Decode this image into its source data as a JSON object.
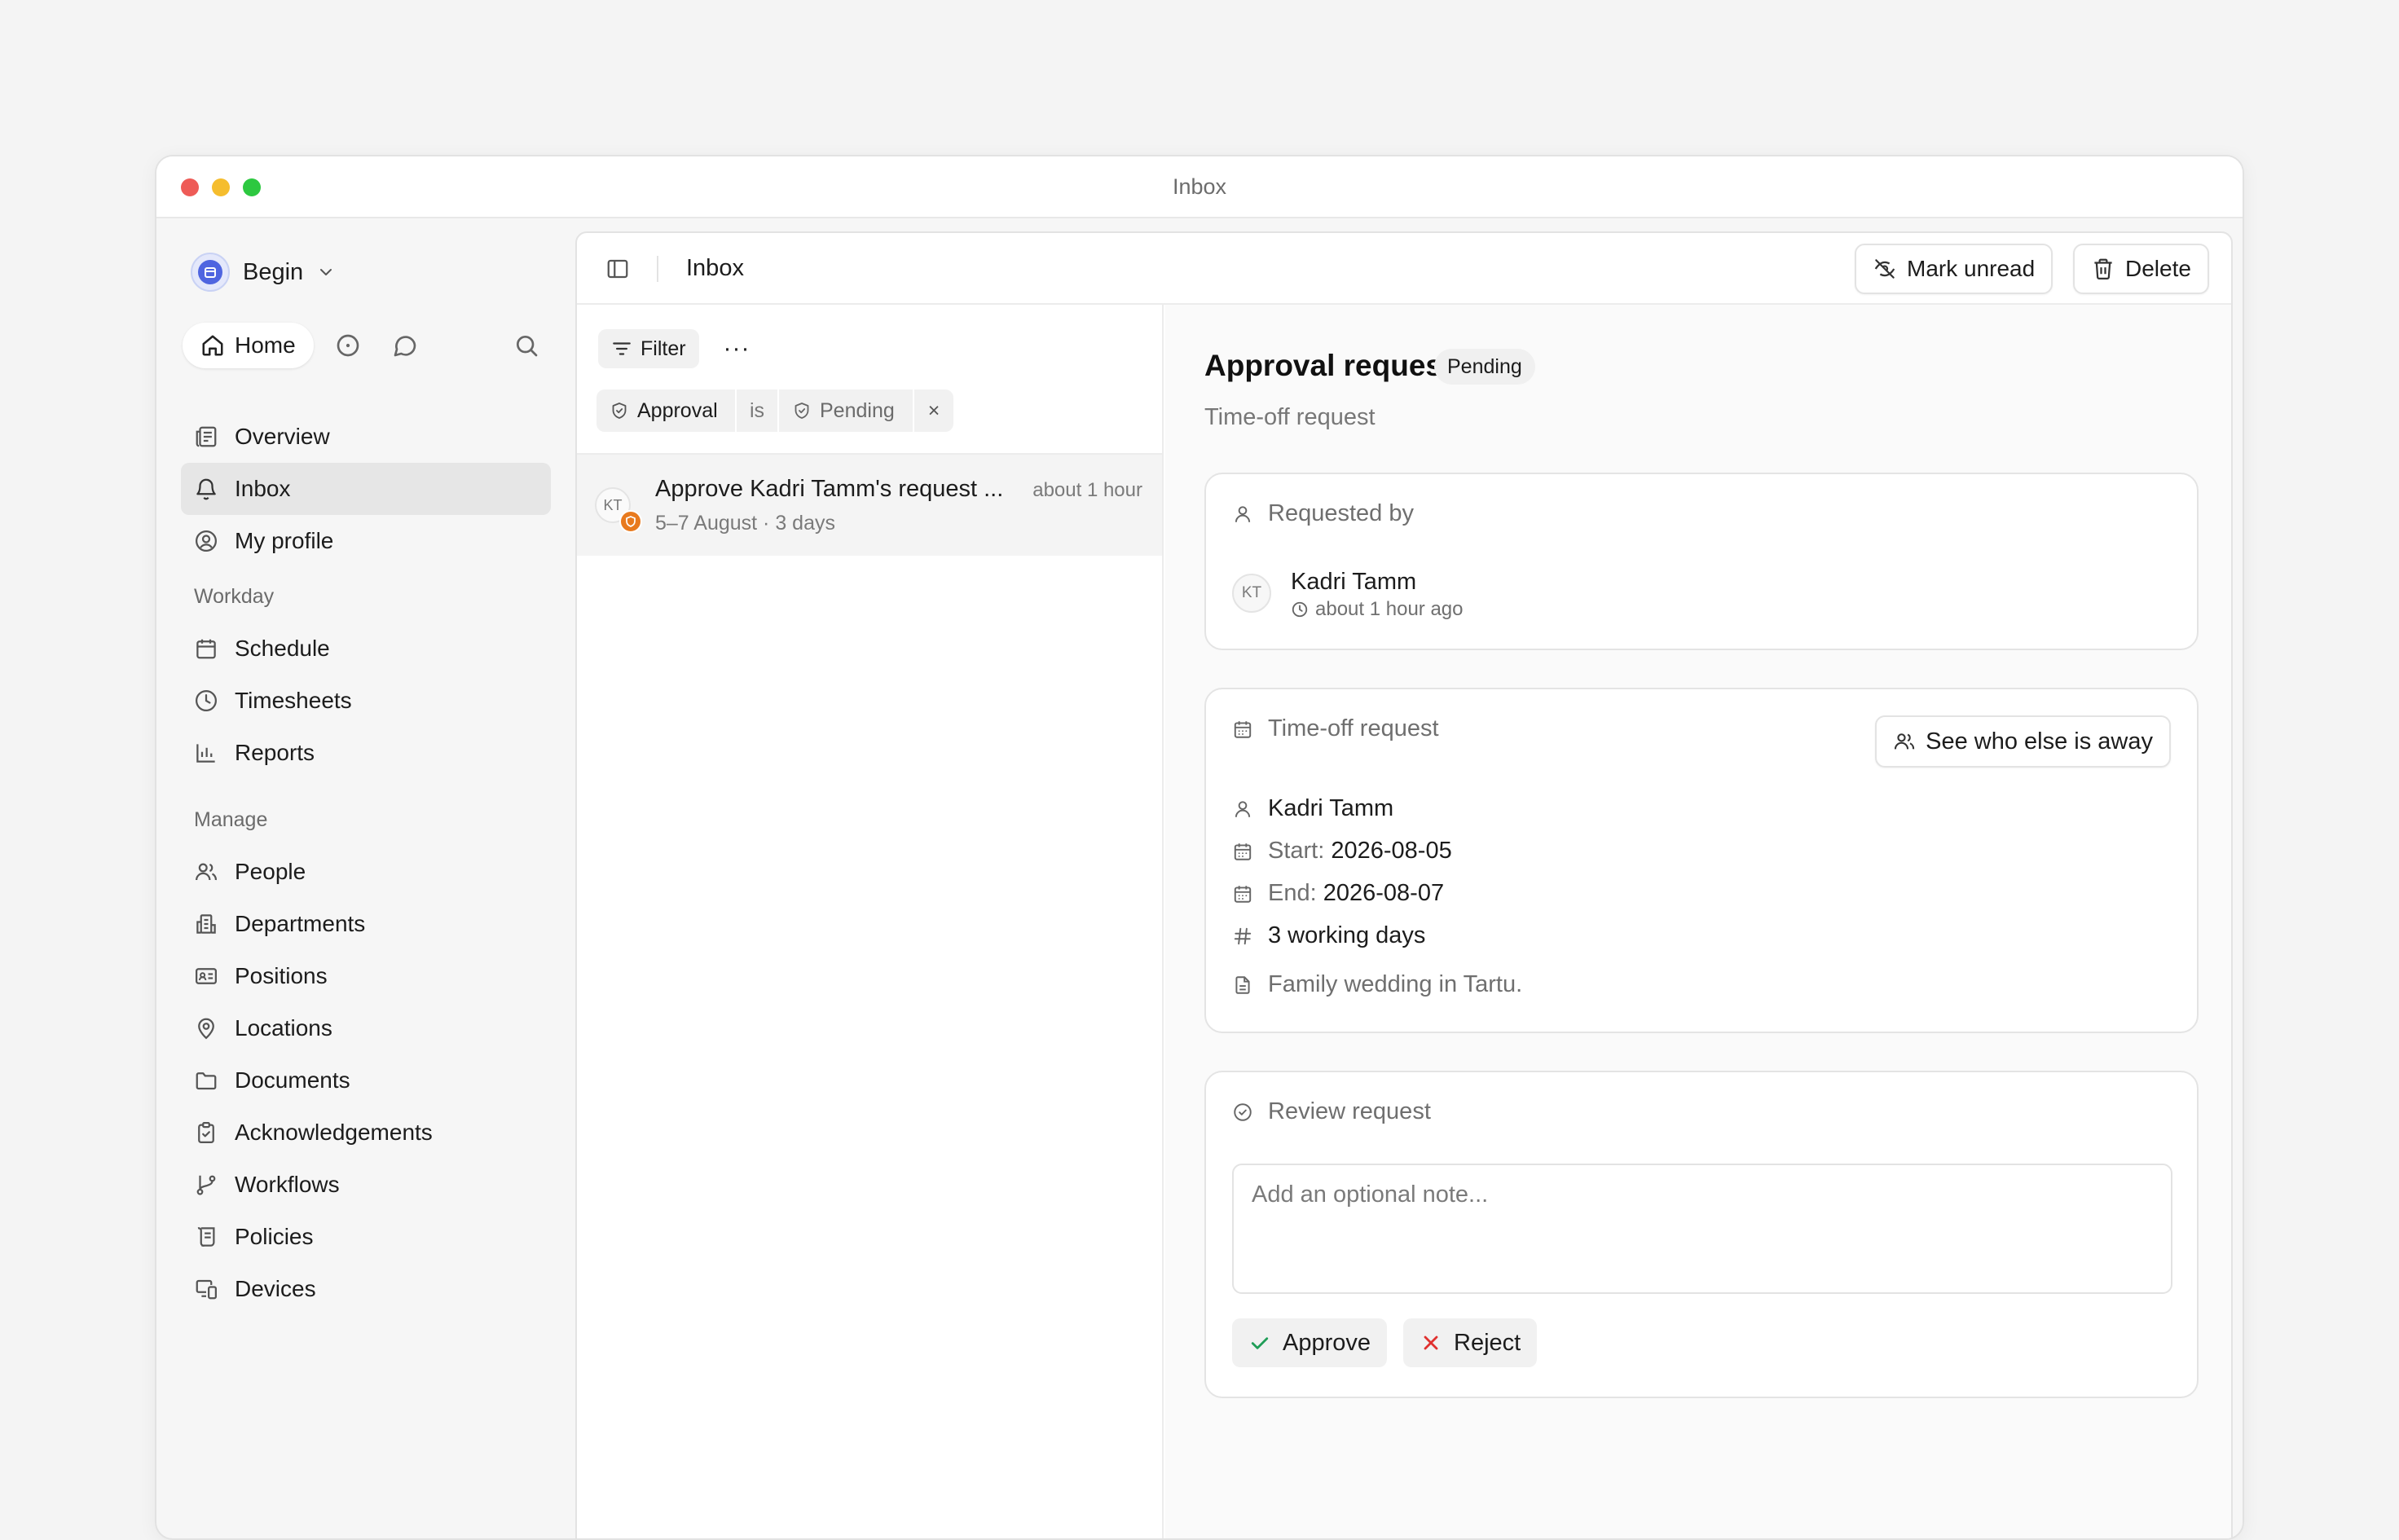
{
  "window": {
    "title": "Inbox"
  },
  "sidebar": {
    "workspace": "Begin",
    "home_label": "Home",
    "primary": [
      {
        "label": "Overview",
        "icon": "newspaper-icon"
      },
      {
        "label": "Inbox",
        "icon": "bell-icon",
        "active": true
      },
      {
        "label": "My profile",
        "icon": "user-circle-icon"
      }
    ],
    "workday_label": "Workday",
    "workday": [
      {
        "label": "Schedule",
        "icon": "calendar-icon"
      },
      {
        "label": "Timesheets",
        "icon": "clock-icon"
      },
      {
        "label": "Reports",
        "icon": "bar-chart-icon"
      }
    ],
    "manage_label": "Manage",
    "manage": [
      {
        "label": "People",
        "icon": "users-icon"
      },
      {
        "label": "Departments",
        "icon": "building-icon"
      },
      {
        "label": "Positions",
        "icon": "id-card-icon"
      },
      {
        "label": "Locations",
        "icon": "map-pin-icon"
      },
      {
        "label": "Documents",
        "icon": "folder-icon"
      },
      {
        "label": "Acknowledgements",
        "icon": "clipboard-check-icon"
      },
      {
        "label": "Workflows",
        "icon": "git-branch-icon"
      },
      {
        "label": "Policies",
        "icon": "scroll-icon"
      },
      {
        "label": "Devices",
        "icon": "monitor-smartphone-icon"
      }
    ]
  },
  "header": {
    "title": "Inbox",
    "mark_unread": "Mark unread",
    "delete": "Delete"
  },
  "list": {
    "filter_label": "Filter",
    "more": "···",
    "chips": {
      "field": "Approval",
      "operator": "is",
      "value": "Pending",
      "clear": "×"
    },
    "items": [
      {
        "initials": "KT",
        "title": "Approve Kadri Tamm's request ...",
        "time": "about 1 hour",
        "subtitle": "5–7 August · 3 days"
      }
    ]
  },
  "detail": {
    "title": "Approval request",
    "status": "Pending",
    "subtitle": "Time-off request",
    "requested_by": {
      "heading": "Requested by",
      "initials": "KT",
      "name": "Kadri Tamm",
      "time": "about 1 hour ago"
    },
    "timeoff": {
      "heading": "Time-off request",
      "see_away": "See who else is away",
      "person": "Kadri Tamm",
      "start_label": "Start:",
      "start": "2026-08-05",
      "end_label": "End:",
      "end": "2026-08-07",
      "days": "3 working days",
      "reason": "Family wedding in Tartu."
    },
    "review": {
      "heading": "Review request",
      "placeholder": "Add an optional note...",
      "approve": "Approve",
      "reject": "Reject"
    }
  },
  "colors": {
    "accent": "#4f65e0",
    "badge_orange": "#e87a1e",
    "approve_green": "#1f9d57",
    "reject_red": "#e0312f"
  }
}
